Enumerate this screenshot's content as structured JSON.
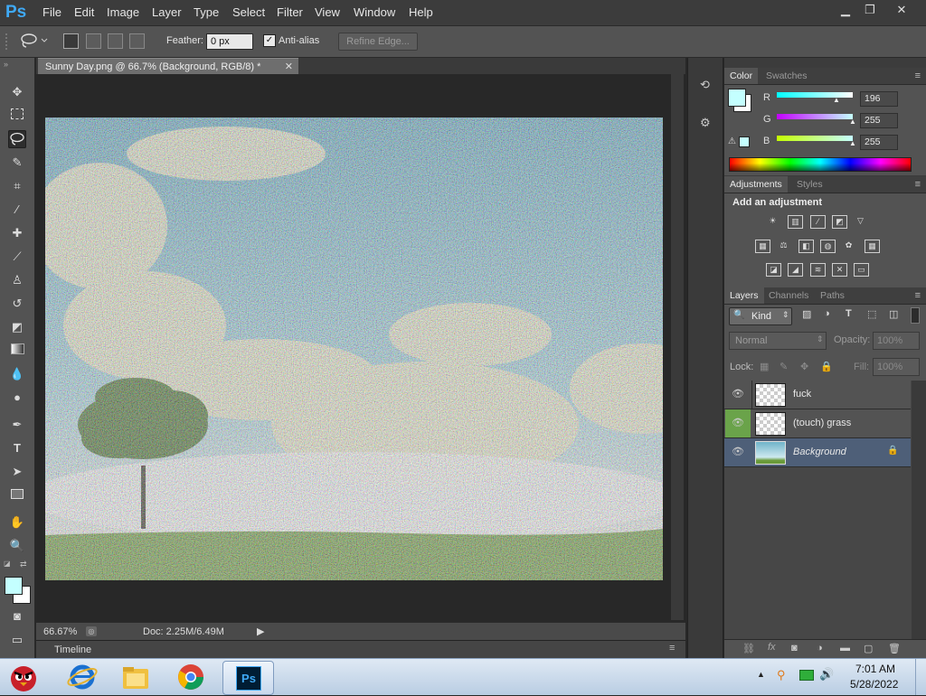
{
  "app": {
    "logo": "Ps"
  },
  "menu": [
    "File",
    "Edit",
    "Image",
    "Layer",
    "Type",
    "Select",
    "Filter",
    "View",
    "Window",
    "Help"
  ],
  "window_controls": {
    "minimize": "▁",
    "restore": "❐",
    "close": "✕"
  },
  "options": {
    "feather_label": "Feather:",
    "feather_value": "0 px",
    "antialias_label": "Anti-alias",
    "antialias_checked": true,
    "refine_label": "Refine Edge..."
  },
  "document": {
    "tab_title": "Sunny Day.png @ 66.7% (Background, RGB/8) *",
    "zoom": "66.67%",
    "doc_info": "Doc: 2.25M/6.49M",
    "timeline_label": "Timeline"
  },
  "color_panel": {
    "tabs": [
      "Color",
      "Swatches"
    ],
    "channels": [
      {
        "label": "R",
        "value": "196"
      },
      {
        "label": "G",
        "value": "255"
      },
      {
        "label": "B",
        "value": "255"
      }
    ],
    "foreground": "#c4ffff",
    "background": "#ffffff"
  },
  "adjustments_panel": {
    "tabs": [
      "Adjustments",
      "Styles"
    ],
    "heading": "Add an adjustment"
  },
  "layers_panel": {
    "tabs": [
      "Layers",
      "Channels",
      "Paths"
    ],
    "filter_kind": "Kind",
    "blend_mode": "Normal",
    "opacity_label": "Opacity:",
    "opacity_value": "100%",
    "lock_label": "Lock:",
    "fill_label": "Fill:",
    "fill_value": "100%",
    "layers": [
      {
        "name": "fuck"
      },
      {
        "name": "(touch) grass"
      },
      {
        "name": "Background"
      }
    ]
  },
  "taskbar": {
    "time": "7:01 AM",
    "date": "5/28/2022"
  }
}
